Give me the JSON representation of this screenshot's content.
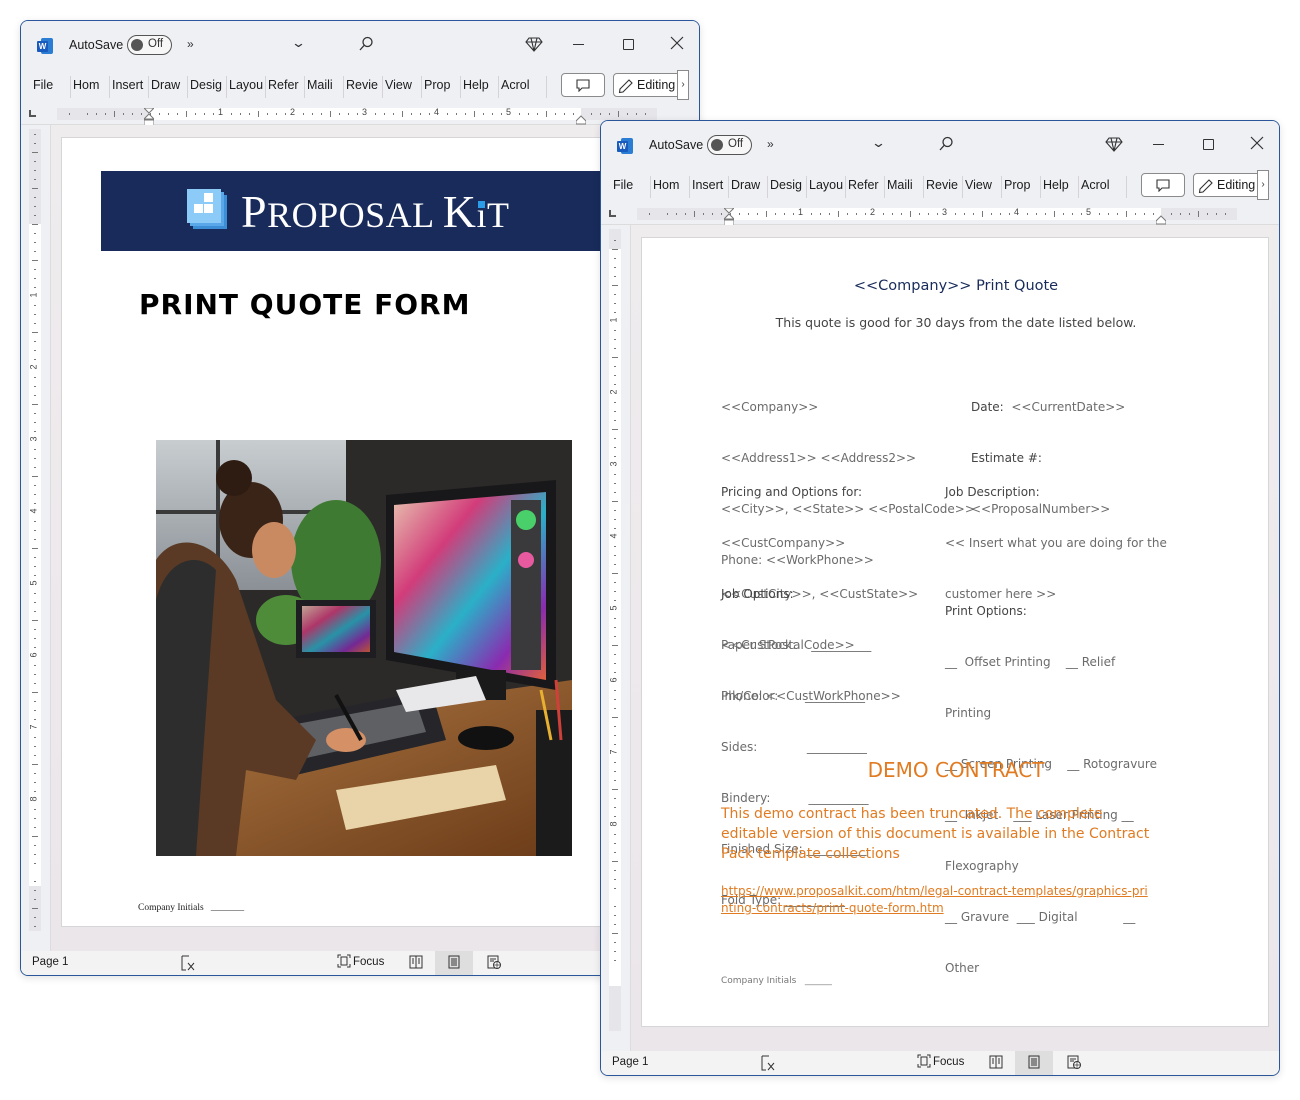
{
  "windows": [
    {
      "id": "left",
      "titlebar": {
        "autosave_label": "AutoSave",
        "autosave_state": "Off",
        "more": "»"
      },
      "ribbon_tabs": [
        "File",
        "Home",
        "Insert",
        "Draw",
        "Design",
        "Layout",
        "References",
        "Mailings",
        "Review",
        "View",
        "Proposal",
        "Help",
        "Acrobat"
      ],
      "ribbon_tabs_visible": [
        "File",
        "Hom",
        "Insert",
        "Draw",
        "Desig",
        "Layou",
        "Refer",
        "Maili",
        "Revie",
        "View",
        "Prop",
        "Help",
        "Acrol"
      ],
      "editing_label": "Editing",
      "ruler_numbers": [
        "1",
        "2",
        "3",
        "4",
        "5"
      ],
      "vruler_numbers": [
        "1",
        "2",
        "3",
        "4",
        "5",
        "6",
        "7",
        "8"
      ],
      "status": {
        "page": "Page 1",
        "focus": "Focus"
      },
      "document": {
        "banner_brand": "Proposal Kit",
        "banner_brand_parts": [
          "P",
          "ROPOSAL ",
          "K",
          "i",
          "T"
        ],
        "title": "PRINT QUOTE FORM",
        "image_alt": "Woman drawing on a graphics tablet beside a monitor displaying colorful digital artwork",
        "initials_label": "Company Initials",
        "initials_blank": "_______"
      }
    },
    {
      "id": "right",
      "titlebar": {
        "autosave_label": "AutoSave",
        "autosave_state": "Off",
        "more": "»"
      },
      "ribbon_tabs_visible": [
        "File",
        "Hom",
        "Insert",
        "Draw",
        "Desig",
        "Layou",
        "Refer",
        "Maili",
        "Revie",
        "View",
        "Prop",
        "Help",
        "Acrol"
      ],
      "editing_label": "Editing",
      "ruler_numbers": [
        "1",
        "2",
        "3",
        "4",
        "5"
      ],
      "vruler_numbers": [
        "1",
        "2",
        "3",
        "4",
        "5",
        "6",
        "7",
        "8"
      ],
      "status": {
        "page": "Page 1",
        "focus": "Focus"
      },
      "document": {
        "title": "<<Company>> Print Quote",
        "subtitle": "This quote is good for 30 days from the date listed below.",
        "company_block": [
          "<<Company>>",
          "<<Address1>> <<Address2>>",
          "<<City>>, <<State>> <<PostalCode>>",
          "Phone: <<WorkPhone>>"
        ],
        "date_label": "Date:",
        "date_value": "<<CurrentDate>>",
        "estimate_label": "Estimate #:",
        "estimate_value": "<<ProposalNumber>>",
        "pricing_heading": "Pricing and Options for:",
        "pricing_lines": [
          "<<CustCompany>>",
          "<<CustCity>>, <<CustState>>",
          "<<CustPostalCode>>",
          "Phone: <<CustWorkPhone>>"
        ],
        "job_desc_heading": "Job Description:",
        "job_desc_lines": [
          "<< Insert what you are doing for the",
          "customer here >>"
        ],
        "job_options_heading": "Job Options:",
        "job_options": [
          "Paper Stock:    __________",
          "Ink/Color:       __________",
          "Sides:             __________",
          "Bindery:          __________",
          "Finished Size: __________",
          "Fold Type: __________"
        ],
        "print_options_heading": "Print Options:",
        "print_options_lines": [
          "__  Offset Printing    __ Relief",
          "Printing",
          "__ Screen Printing    __ Rotogravure",
          "__  Inkjet    ___ Laser Printing __",
          "Flexography",
          "__ Gravure  ___ Digital            __",
          "Other"
        ],
        "demo_title": "DEMO CONTRACT",
        "demo_text": "This demo contract has been truncated. The complete editable version of this document is available in the Contract Pack template collections",
        "demo_link": "https://www.proposalkit.com/htm/legal-contract-templates/graphics-printing-contracts/print-quote-form.htm",
        "initials_label": "Company Initials",
        "initials_blank": "______"
      }
    }
  ],
  "colors": {
    "window_border": "#2b579a",
    "banner_navy": "#182b5a",
    "demo_orange": "#e07b22",
    "word_blue": "#185abd"
  }
}
